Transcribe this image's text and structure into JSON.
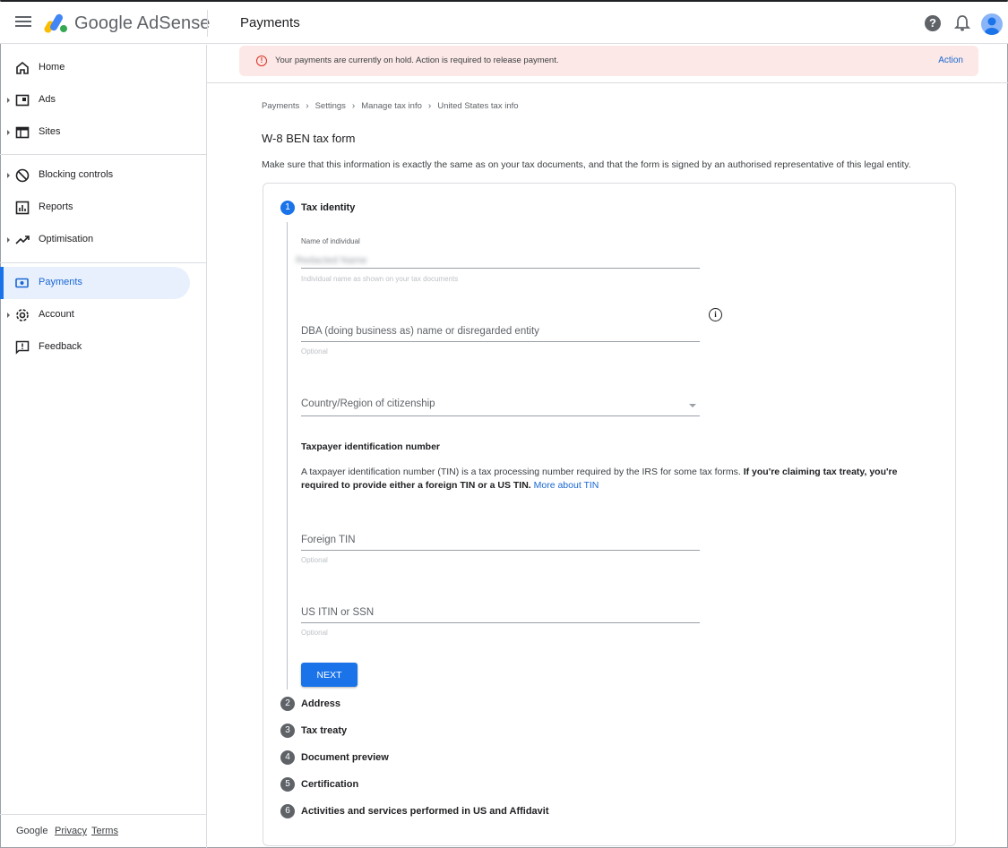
{
  "app": {
    "brand": "Google AdSense",
    "page_title": "Payments"
  },
  "topbar_icons": [
    "menu-icon",
    "adsense-logo-icon",
    "help-icon",
    "bell-icon",
    "avatar-icon"
  ],
  "sidebar": {
    "items": [
      {
        "label": "Home",
        "icon": "home-icon",
        "has_caret": false
      },
      {
        "label": "Ads",
        "icon": "ads-icon",
        "has_caret": true
      },
      {
        "label": "Sites",
        "icon": "sites-icon",
        "has_caret": true
      },
      {
        "label": "Blocking controls",
        "icon": "block-icon",
        "has_caret": true
      },
      {
        "label": "Reports",
        "icon": "reports-icon",
        "has_caret": false
      },
      {
        "label": "Optimisation",
        "icon": "trending-icon",
        "has_caret": true
      },
      {
        "label": "Payments",
        "icon": "payments-icon",
        "has_caret": false,
        "active": true
      },
      {
        "label": "Account",
        "icon": "gear-icon",
        "has_caret": true
      },
      {
        "label": "Feedback",
        "icon": "feedback-icon",
        "has_caret": false
      }
    ],
    "footer": {
      "brand": "Google",
      "privacy": "Privacy",
      "terms": "Terms"
    }
  },
  "alert": {
    "text": "Your payments are currently on hold. Action is required to release payment.",
    "action": "Action",
    "icon": "alert-circle-icon"
  },
  "breadcrumb": [
    "Payments",
    "Settings",
    "Manage tax info",
    "United States tax info"
  ],
  "form": {
    "title": "W-8 BEN tax form",
    "description": "Make sure that this information is exactly the same as on your tax documents, and that the form is signed by an authorised representative of this legal entity.",
    "steps": [
      {
        "num": "1",
        "label": "Tax identity",
        "active": true
      },
      {
        "num": "2",
        "label": "Address"
      },
      {
        "num": "3",
        "label": "Tax treaty"
      },
      {
        "num": "4",
        "label": "Document preview"
      },
      {
        "num": "5",
        "label": "Certification"
      },
      {
        "num": "6",
        "label": "Activities and services performed in US and Affidavit"
      }
    ],
    "fields": {
      "name": {
        "label": "Name of individual",
        "value": "Redacted Name",
        "help": "Individual name as shown on your tax documents"
      },
      "dba": {
        "placeholder": "DBA (doing business as) name or disregarded entity",
        "help": "Optional"
      },
      "country": {
        "placeholder": "Country/Region of citizenship"
      },
      "foreign_tin": {
        "placeholder": "Foreign TIN",
        "help": "Optional"
      },
      "us_itin": {
        "placeholder": "US ITIN or SSN",
        "help": "Optional"
      }
    },
    "tin": {
      "heading": "Taxpayer identification number",
      "text": "A taxpayer identification number (TIN) is a tax processing number required by the IRS for some tax forms. ",
      "bold": "If you're claiming tax treaty, you're required to provide either a foreign TIN or a US TIN.",
      "link": "More about TIN"
    },
    "next_label": "NEXT"
  },
  "colors": {
    "accent": "#1a73e8",
    "alert_bg": "#fce8e6",
    "alert_icon": "#d93025"
  }
}
